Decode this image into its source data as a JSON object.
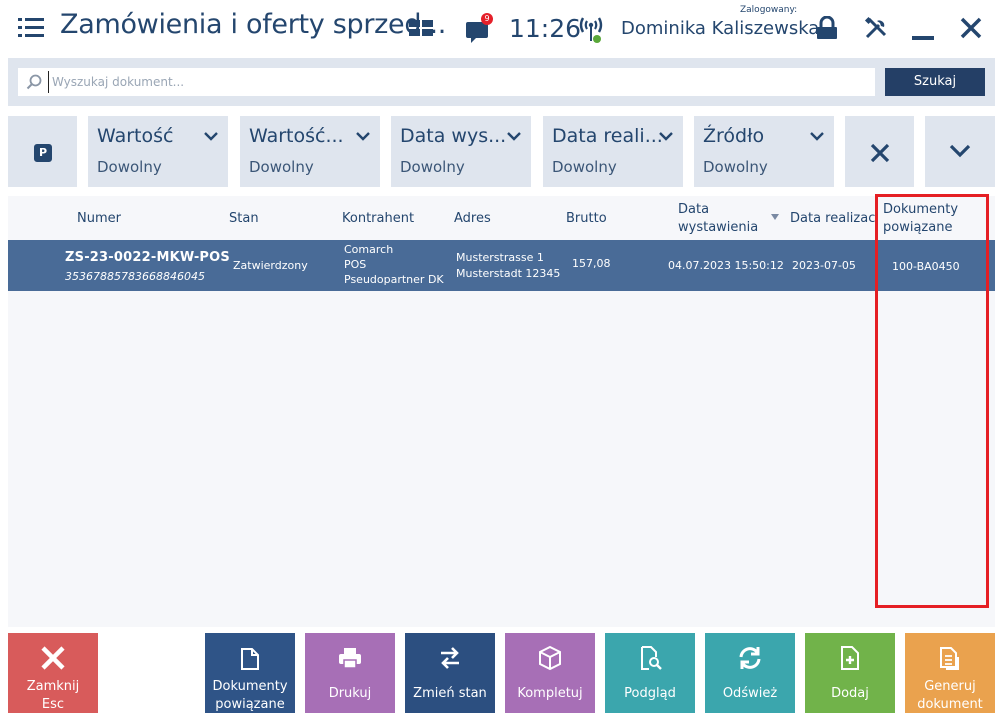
{
  "header": {
    "title": "Zamówienia i oferty sprzed...",
    "notification_count": "9",
    "time": "11:26",
    "logged_label": "Zalogowany:",
    "user": "Dominika Kaliszewska"
  },
  "search": {
    "placeholder": "Wyszukaj dokument...",
    "button": "Szukaj"
  },
  "filters": [
    {
      "title": "Wartość",
      "value": "Dowolny"
    },
    {
      "title": "Wartość...",
      "value": "Dowolny"
    },
    {
      "title": "Data wys...",
      "value": "Dowolny"
    },
    {
      "title": "Data reali...",
      "value": "Dowolny"
    },
    {
      "title": "Źródło",
      "value": "Dowolny"
    }
  ],
  "table": {
    "columns": {
      "numer": "Numer",
      "stan": "Stan",
      "kontrahent": "Kontrahent",
      "adres": "Adres",
      "brutto": "Brutto",
      "data_wyst_1": "Data",
      "data_wyst_2": "wystawienia",
      "data_real": "Data realizacji",
      "dok_pow_1": "Dokumenty",
      "dok_pow_2": "powiązane"
    },
    "rows": [
      {
        "numer": "ZS-23-0022-MKW-POS",
        "kod": "3536788578366884604​5",
        "stan": "Zatwierdzony",
        "kontrahent_1": "Comarch",
        "kontrahent_2": "POS",
        "kontrahent_3": "Pseudopartner DK",
        "adres_1": "Musterstrasse 1",
        "adres_2": "Musterstadt 12345",
        "brutto": "157,08",
        "data_wyst": "04.07.2023 15:50:12",
        "data_real": "2023-07-05",
        "dok_pow": "100-BA0450"
      }
    ]
  },
  "toolbar": {
    "close_1": "Zamknij",
    "close_2": "Esc",
    "related_1": "Dokumenty",
    "related_2": "powiązane",
    "print": "Drukuj",
    "change_state": "Zmień stan",
    "complete": "Kompletuj",
    "preview": "Podgląd",
    "refresh": "Odśwież",
    "add": "Dodaj",
    "generate_1": "Generuj",
    "generate_2": "dokument"
  },
  "colors": {
    "navy": "#24466e",
    "close": "#d85b5b",
    "related": "#2f5487",
    "print": "#a76fb6",
    "change_state": "#2c4f80",
    "complete": "#a76fb6",
    "preview": "#3ba6ad",
    "refresh": "#3ba6ad",
    "add": "#71b34a",
    "generate": "#eaa24e",
    "highlight": "#e51f24"
  }
}
